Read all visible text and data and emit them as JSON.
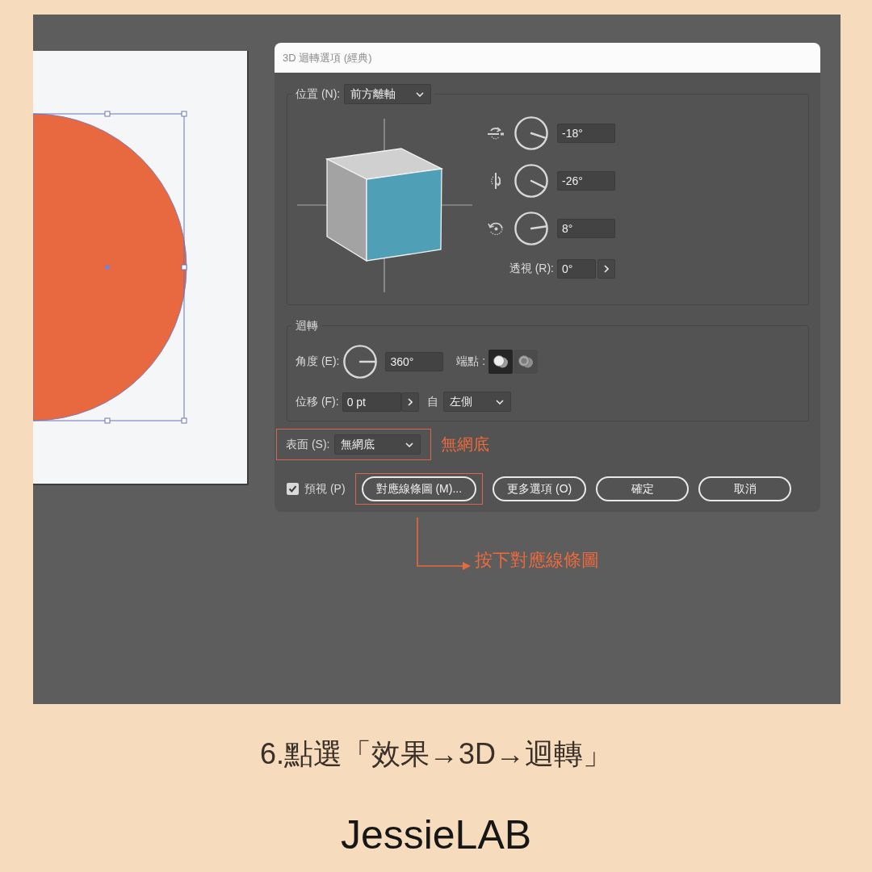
{
  "dialog": {
    "title": "3D 迴轉選項 (經典)",
    "position": {
      "label": "位置 (N):",
      "value": "前方離軸"
    },
    "rotations": [
      {
        "kind": "x",
        "value": "-18°"
      },
      {
        "kind": "y",
        "value": "-26°"
      },
      {
        "kind": "z",
        "value": "8°"
      }
    ],
    "perspective": {
      "label": "透視 (R):",
      "value": "0°"
    },
    "revolve": {
      "title": "迴轉",
      "angle": {
        "label": "角度 (E):",
        "value": "360°"
      },
      "cap": {
        "label": "端點 :",
        "options": [
          {
            "kind": "solid",
            "selected": true
          },
          {
            "kind": "hollow",
            "selected": false
          }
        ]
      },
      "offset": {
        "label": "位移 (F):",
        "value": "0 pt",
        "from_label": "自",
        "from_value": "左側"
      }
    },
    "surface": {
      "label": "表面 (S):",
      "value": "無網底",
      "highlighted": true,
      "note": "無網底"
    },
    "preview": {
      "label": "預視 (P)",
      "checked": true
    },
    "buttons": [
      {
        "label": "對應線條圖 (M)...",
        "highlighted": true
      },
      {
        "label": "更多選項 (O)",
        "highlighted": false
      },
      {
        "label": "確定",
        "highlighted": false
      },
      {
        "label": "取消",
        "highlighted": false
      }
    ]
  },
  "callout": "按下對應線條圖",
  "caption": "6.點選「效果→3D→迴轉」",
  "brand": "JessieLAB"
}
